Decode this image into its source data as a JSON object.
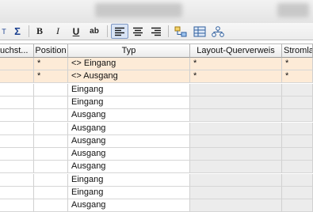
{
  "toolbar": {
    "font_size_label": "T",
    "sum_label": "Σ",
    "bold_label": "B",
    "italic_label": "I",
    "underline_label": "U",
    "strike_label": "ab"
  },
  "table": {
    "headers": {
      "col0": "uchst...",
      "col1": "Position",
      "col2": "Typ",
      "col3": "Layout-Querverweis",
      "col4": "Stromla"
    },
    "rows": [
      {
        "position": "*",
        "typ": "<> Eingang",
        "layout": "*",
        "strom": "*"
      },
      {
        "position": "*",
        "typ": "<> Ausgang",
        "layout": "*",
        "strom": "*"
      },
      {
        "position": "",
        "typ": "Eingang",
        "layout": "",
        "strom": ""
      },
      {
        "position": "",
        "typ": "Eingang",
        "layout": "",
        "strom": ""
      },
      {
        "position": "",
        "typ": "Ausgang",
        "layout": "",
        "strom": ""
      },
      {
        "position": "",
        "typ": "Ausgang",
        "layout": "",
        "strom": ""
      },
      {
        "position": "",
        "typ": "Ausgang",
        "layout": "",
        "strom": ""
      },
      {
        "position": "",
        "typ": "Ausgang",
        "layout": "",
        "strom": ""
      },
      {
        "position": "",
        "typ": "Ausgang",
        "layout": "",
        "strom": ""
      },
      {
        "position": "",
        "typ": "Eingang",
        "layout": "",
        "strom": ""
      },
      {
        "position": "",
        "typ": "Eingang",
        "layout": "",
        "strom": ""
      },
      {
        "position": "",
        "typ": "Ausgang",
        "layout": "",
        "strom": ""
      }
    ]
  },
  "colors": {
    "template_row_bg": "#fdebd7",
    "readonly_cell_bg": "#ececec",
    "active_button_bg": "#d9e4f5"
  }
}
